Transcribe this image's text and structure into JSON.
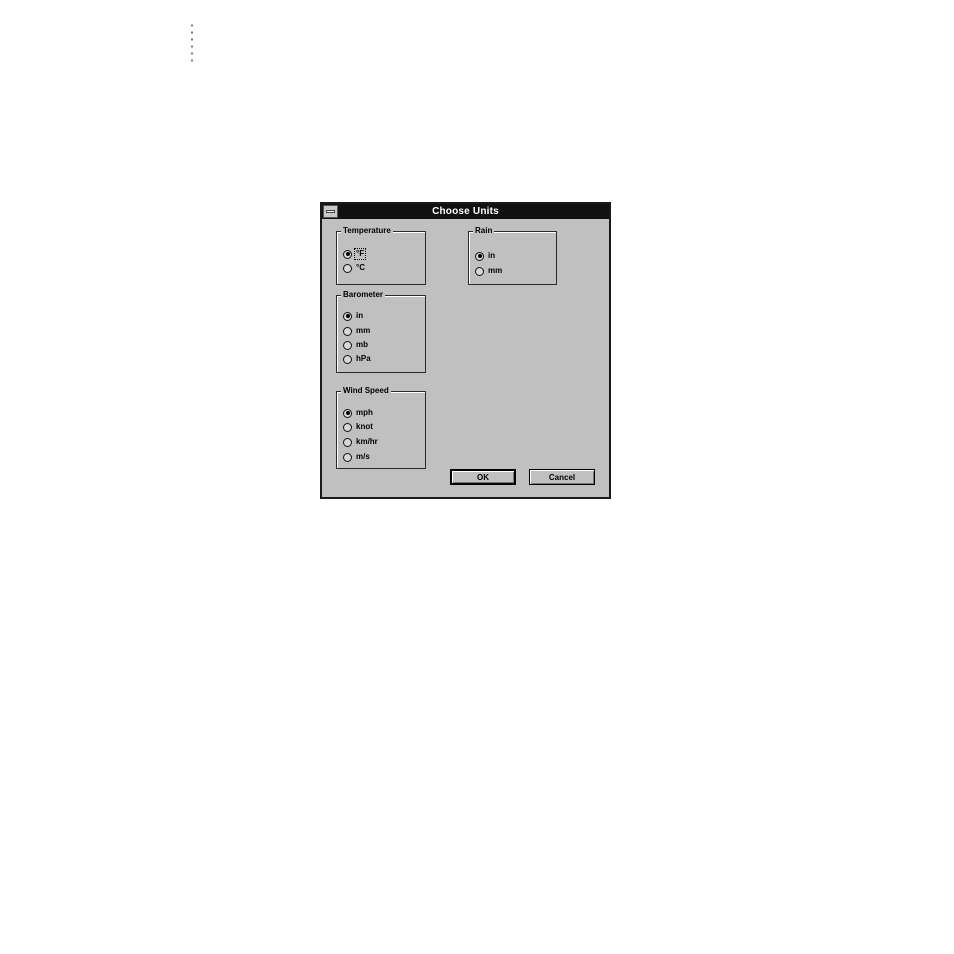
{
  "dialog": {
    "title": "Choose Units",
    "groups": {
      "temperature": {
        "label": "Temperature",
        "options": [
          {
            "label": "°F",
            "selected": true,
            "focused": true
          },
          {
            "label": "°C",
            "selected": false
          }
        ]
      },
      "rain": {
        "label": "Rain",
        "options": [
          {
            "label": "in",
            "selected": true
          },
          {
            "label": "mm",
            "selected": false
          }
        ]
      },
      "barometer": {
        "label": "Barometer",
        "options": [
          {
            "label": "in",
            "selected": true
          },
          {
            "label": "mm",
            "selected": false
          },
          {
            "label": "mb",
            "selected": false
          },
          {
            "label": "hPa",
            "selected": false
          }
        ]
      },
      "wind_speed": {
        "label": "Wind Speed",
        "options": [
          {
            "label": "mph",
            "selected": true
          },
          {
            "label": "knot",
            "selected": false
          },
          {
            "label": "km/hr",
            "selected": false
          },
          {
            "label": "m/s",
            "selected": false
          }
        ]
      }
    },
    "buttons": {
      "ok": "OK",
      "cancel": "Cancel"
    }
  },
  "icons": {
    "system_menu": "system-menu-icon"
  }
}
